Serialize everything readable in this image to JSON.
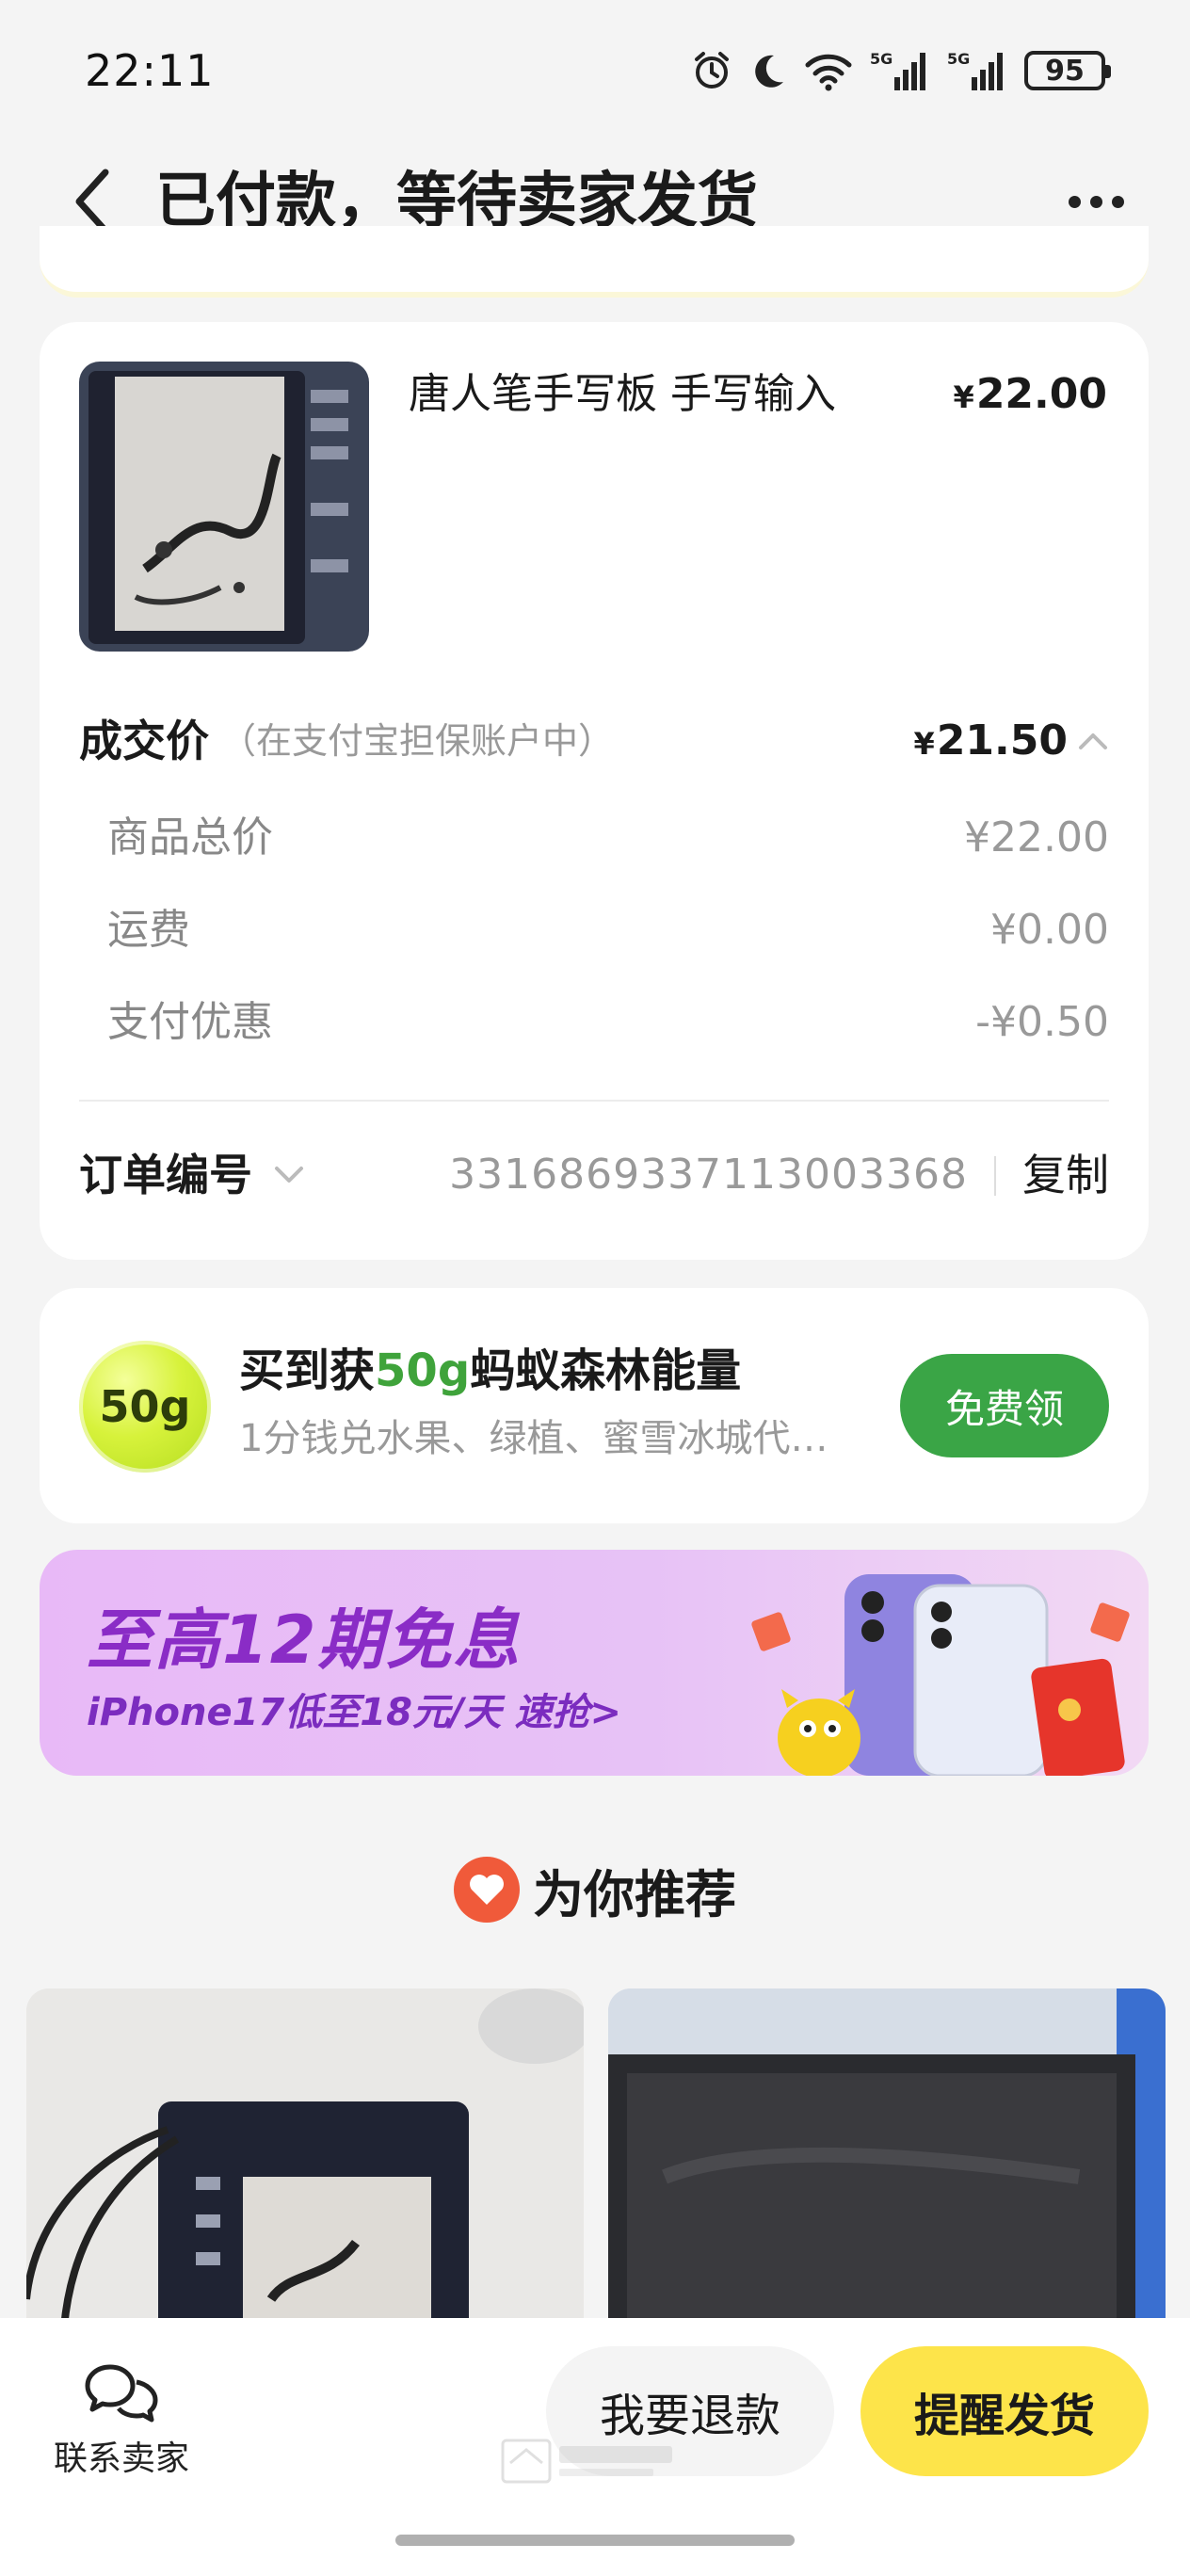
{
  "status_bar": {
    "time": "22:11",
    "battery": "95",
    "signal_labels": [
      "5G",
      "5G"
    ]
  },
  "nav": {
    "title": "已付款，等待卖家发货"
  },
  "order": {
    "product_title": "唐人笔手写板 手写输入",
    "currency": "¥",
    "product_price": "22.00",
    "deal_label": "成交价",
    "deal_note": "（在支付宝担保账户中）",
    "deal_price": "21.50",
    "breakdown": [
      {
        "label": "商品总价",
        "value": "¥22.00"
      },
      {
        "label": "运费",
        "value": "¥0.00"
      },
      {
        "label": "支付优惠",
        "value": "-¥0.50"
      }
    ],
    "order_no_label": "订单编号",
    "order_no": "3316869337113003368",
    "copy_label": "复制"
  },
  "energy": {
    "badge": "50g",
    "title_prefix": "买到获",
    "title_highlight": "50g",
    "title_suffix": "蚂蚁森林能量",
    "subtitle": "1分钱兑水果、绿植、蜜雪冰城代…",
    "button": "免费领",
    "accent": "#3aa546"
  },
  "promo": {
    "title": "至高12期免息",
    "subtitle": "iPhone17低至18元/天  速抢>",
    "color": "#8a2cc6"
  },
  "recommend": {
    "title": "为你推荐"
  },
  "bottom": {
    "contact_label": "联系卖家",
    "refund_label": "我要退款",
    "remind_label": "提醒发货",
    "remind_color": "#fde44a"
  }
}
